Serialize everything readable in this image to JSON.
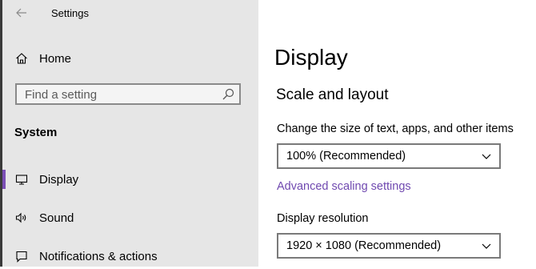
{
  "window": {
    "title": "Settings"
  },
  "sidebar": {
    "home_label": "Home",
    "search": {
      "placeholder": "Find a setting"
    },
    "section_label": "System",
    "items": [
      {
        "label": "Display",
        "icon": "monitor-icon",
        "active": true
      },
      {
        "label": "Sound",
        "icon": "speaker-icon",
        "active": false
      },
      {
        "label": "Notifications & actions",
        "icon": "notification-icon",
        "active": false
      }
    ]
  },
  "main": {
    "page_title": "Display",
    "section_title": "Scale and layout",
    "scale": {
      "label": "Change the size of text, apps, and other items",
      "selected": "100% (Recommended)"
    },
    "advanced_link": "Advanced scaling settings",
    "resolution": {
      "label": "Display resolution",
      "selected": "1920 × 1080 (Recommended)"
    }
  },
  "colors": {
    "sidebar_bg": "#e6e6e6",
    "accent": "#7b4fb5",
    "link": "#7049b0"
  }
}
